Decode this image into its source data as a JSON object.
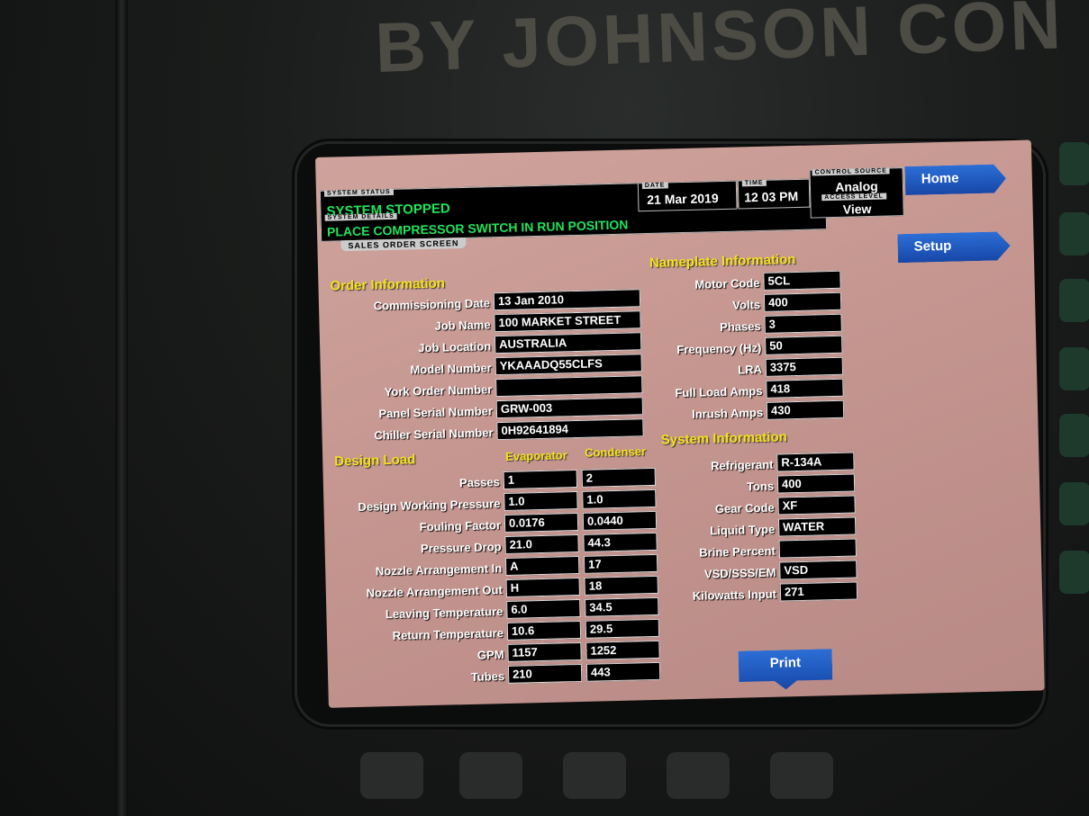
{
  "brand": "BY JOHNSON CON",
  "header": {
    "system_status_caption": "SYSTEM STATUS",
    "system_status": "SYSTEM STOPPED",
    "system_details_caption": "SYSTEM DETAILS",
    "system_details": "PLACE COMPRESSOR SWITCH IN RUN POSITION",
    "screen_name": "SALES ORDER SCREEN",
    "date_caption": "DATE",
    "date": "21 Mar 2019",
    "time_caption": "TIME",
    "time": "12 03 PM",
    "control_source_caption": "CONTROL SOURCE",
    "control_source": "Analog",
    "access_level_caption": "ACCESS LEVEL",
    "access_level": "View"
  },
  "nav": {
    "home": "Home",
    "setup": "Setup",
    "print": "Print"
  },
  "order_information": {
    "title": "Order Information",
    "rows": [
      {
        "label": "Commissioning Date",
        "value": "13 Jan 2010"
      },
      {
        "label": "Job Name",
        "value": "100 MARKET STREET"
      },
      {
        "label": "Job Location",
        "value": "AUSTRALIA"
      },
      {
        "label": "Model Number",
        "value": "YKAAADQ55CLFS"
      },
      {
        "label": "York Order Number",
        "value": ""
      },
      {
        "label": "Panel Serial Number",
        "value": "GRW-003"
      },
      {
        "label": "Chiller Serial Number",
        "value": "0H92641894"
      }
    ]
  },
  "nameplate_information": {
    "title": "Nameplate Information",
    "rows": [
      {
        "label": "Motor Code",
        "value": "5CL"
      },
      {
        "label": "Volts",
        "value": "400"
      },
      {
        "label": "Phases",
        "value": "3"
      },
      {
        "label": "Frequency (Hz)",
        "value": "50"
      },
      {
        "label": "LRA",
        "value": "3375"
      },
      {
        "label": "Full Load Amps",
        "value": "418"
      },
      {
        "label": "Inrush Amps",
        "value": "430"
      }
    ]
  },
  "design_load": {
    "title": "Design Load",
    "col_evaporator": "Evaporator",
    "col_condenser": "Condenser",
    "rows": [
      {
        "label": "Passes",
        "evaporator": "1",
        "condenser": "2"
      },
      {
        "label": "Design Working Pressure",
        "evaporator": "1.0",
        "condenser": "1.0"
      },
      {
        "label": "Fouling Factor",
        "evaporator": "0.0176",
        "condenser": "0.0440"
      },
      {
        "label": "Pressure Drop",
        "evaporator": "21.0",
        "condenser": "44.3"
      },
      {
        "label": "Nozzle Arrangement In",
        "evaporator": "A",
        "condenser": "17"
      },
      {
        "label": "Nozzle Arrangement Out",
        "evaporator": "H",
        "condenser": "18"
      },
      {
        "label": "Leaving Temperature",
        "evaporator": "6.0",
        "condenser": "34.5"
      },
      {
        "label": "Return Temperature",
        "evaporator": "10.6",
        "condenser": "29.5"
      },
      {
        "label": "GPM",
        "evaporator": "1157",
        "condenser": "1252"
      },
      {
        "label": "Tubes",
        "evaporator": "210",
        "condenser": "443"
      }
    ]
  },
  "system_information": {
    "title": "System Information",
    "rows": [
      {
        "label": "Refrigerant",
        "value": "R-134A"
      },
      {
        "label": "Tons",
        "value": "400"
      },
      {
        "label": "Gear Code",
        "value": "XF"
      },
      {
        "label": "Liquid Type",
        "value": "WATER"
      },
      {
        "label": "Brine Percent",
        "value": ""
      },
      {
        "label": "VSD/SSS/EM",
        "value": "VSD"
      },
      {
        "label": "Kilowatts Input",
        "value": "271"
      }
    ]
  }
}
